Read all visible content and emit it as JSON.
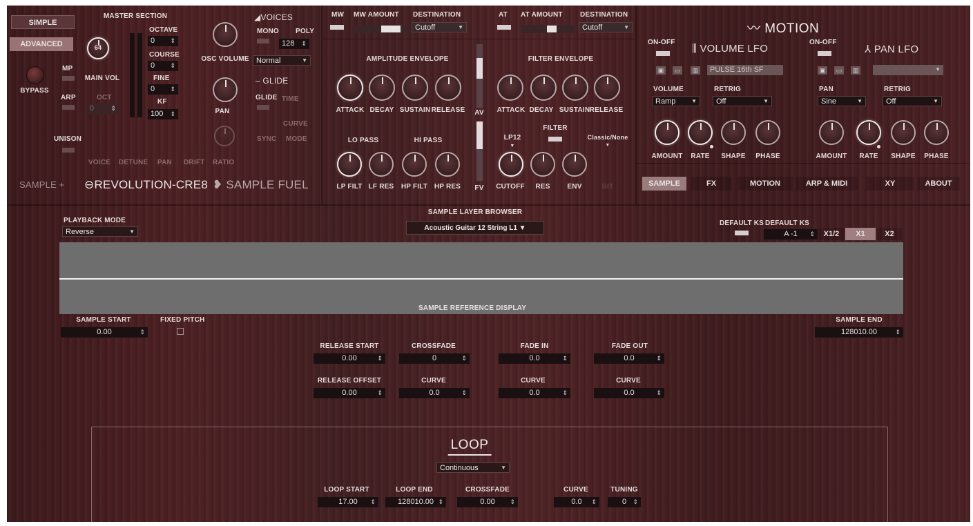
{
  "mode_tabs": {
    "simple": "SIMPLE",
    "advanced": "ADVANCED"
  },
  "master": {
    "title": "MASTER SECTION",
    "main_vol_value": "64",
    "main_vol_label": "MAIN VOL",
    "bypass": "BYPASS",
    "mp": "MP",
    "arp": "ARP",
    "oct": "OCT",
    "oct_value": "0",
    "unison": "UNISON",
    "octave": "OCTAVE",
    "octave_value": "0",
    "course": "COURSE",
    "course_value": "0",
    "fine": "FINE",
    "fine_value": "0",
    "kf": "KF",
    "kf_value": "100",
    "unison_params": [
      "VOICE",
      "DETUNE",
      "PAN",
      "DRIFT",
      "RATIO"
    ]
  },
  "osc": {
    "volume": "OSC VOLUME",
    "pan": "PAN"
  },
  "voices": {
    "title": "VOICES",
    "mono": "MONO",
    "poly": "POLY",
    "poly_value": "128",
    "mode_value": "Normal",
    "glide_title": "GLIDE",
    "glide": "GLIDE",
    "time": "TIME",
    "curve": "CURVE",
    "sync": "SYNC",
    "mode": "MODE"
  },
  "brand": {
    "sample_logo": "SAMPLE",
    "revolution": "REVOLUTION-CRE8",
    "sample_fuel": "SAMPLE FUEL"
  },
  "mod": {
    "mw": "MW",
    "mw_amount": "MW AMOUNT",
    "destination": "DESTINATION",
    "mw_dest": "Cutoff",
    "at": "AT",
    "at_amount": "AT AMOUNT",
    "at_dest": "Cutoff"
  },
  "amp_env": {
    "title": "AMPLITUDE ENVELOPE",
    "attack": "ATTACK",
    "decay": "DECAY",
    "sustain": "SUSTAIN",
    "release": "RELEASE",
    "av": "AV"
  },
  "filters": {
    "lo_pass": "LO PASS",
    "hi_pass": "HI PASS",
    "lp_filt": "LP FILT",
    "lf_res": "LF RES",
    "hp_filt": "HP FILT",
    "hp_res": "HP RES",
    "fv": "FV"
  },
  "filter_env": {
    "title": "FILTER ENVELOPE",
    "attack": "ATTACK",
    "decay": "DECAY",
    "sustain": "SUSTAIN",
    "release": "RELEASE",
    "filter": "FILTER",
    "lp12": "LP12",
    "classic": "Classic/None",
    "cutoff": "CUTOFF",
    "res": "RES",
    "env": "ENV",
    "bit": "BIT"
  },
  "motion": {
    "title": "MOTION",
    "on_off": "ON-OFF",
    "vol_lfo": "VOLUME LFO",
    "pan_lfo": "PAN LFO",
    "preset": "PULSE 16th SF",
    "volume": "VOLUME",
    "volume_value": "Ramp",
    "retrig": "RETRIG",
    "retrig_value": "Off",
    "pan": "PAN",
    "pan_value": "Sine",
    "pan_retrig_value": "Off",
    "amount": "AMOUNT",
    "rate": "RATE",
    "shape": "SHAPE",
    "phase": "PHASE"
  },
  "nav": {
    "tabs": [
      "SAMPLE",
      "FX",
      "MOTION",
      "ARP & MIDI",
      "XY",
      "ABOUT"
    ],
    "selected": "SAMPLE"
  },
  "sample": {
    "playback_mode": "PLAYBACK MODE",
    "playback_value": "Reverse",
    "browser_title": "SAMPLE LAYER BROWSER",
    "browser_value": "Acoustic Guitar 12 String L1",
    "default_ks": "DEFAULT KS",
    "default_ks_value": "A -1",
    "zoom": [
      "X1/2",
      "X1",
      "X2"
    ],
    "zoom_selected": "X1",
    "ref_display": "SAMPLE REFERENCE DISPLAY",
    "sample_start": "SAMPLE START",
    "sample_start_value": "0.00",
    "fixed_pitch": "FIXED PITCH",
    "sample_end": "SAMPLE END",
    "sample_end_value": "128010.00",
    "release_start": "RELEASE START",
    "release_start_value": "0.00",
    "crossfade": "CROSSFADE",
    "crossfade_value": "0",
    "fade_in": "FADE IN",
    "fade_in_value": "0.0",
    "fade_out": "FADE OUT",
    "fade_out_value": "0.0",
    "release_offset": "RELEASE OFFSET",
    "release_offset_value": "0.00",
    "curve": "CURVE",
    "curve1": "0.0",
    "curve2": "0.0",
    "curve3": "0.0"
  },
  "loop": {
    "title": "LOOP",
    "mode_value": "Continuous",
    "loop_start": "LOOP START",
    "loop_start_value": "17.00",
    "loop_end": "LOOP END",
    "loop_end_value": "128010.00",
    "crossfade": "CROSSFADE",
    "crossfade_value": "0.00",
    "curve": "CURVE",
    "curve_value": "0.0",
    "tuning": "TUNING",
    "tuning_value": "0"
  }
}
